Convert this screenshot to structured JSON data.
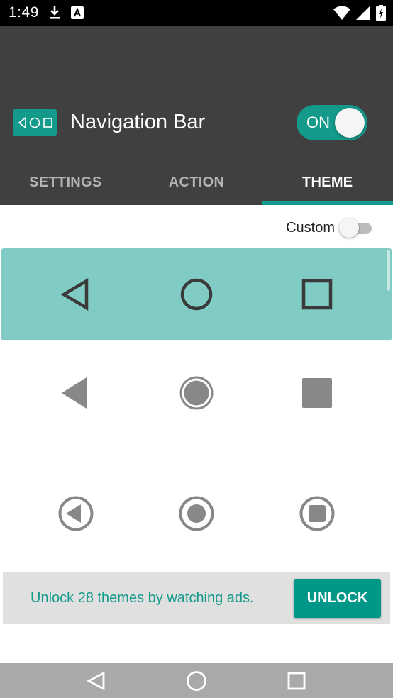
{
  "status_bar": {
    "time": "1:49",
    "left_icons": [
      "download-icon",
      "font-a-icon"
    ],
    "right_icons": [
      "wifi-icon",
      "signal-icon",
      "battery-charging-icon"
    ]
  },
  "app": {
    "title": "Navigation Bar",
    "logo_icon": "navbar-logo-icon",
    "master_toggle": {
      "label": "ON",
      "state": true
    },
    "tabs": [
      {
        "label": "SETTINGS",
        "active": false
      },
      {
        "label": "ACTION",
        "active": false
      },
      {
        "label": "THEME",
        "active": true
      }
    ]
  },
  "theme_panel": {
    "custom_label": "Custom",
    "custom_toggle_state": false,
    "themes": [
      {
        "style": "outline",
        "selected": true,
        "icons": [
          "back-icon",
          "home-icon",
          "recents-icon"
        ]
      },
      {
        "style": "filled",
        "selected": false,
        "icons": [
          "back-icon",
          "home-icon",
          "recents-icon"
        ]
      },
      {
        "style": "circled",
        "selected": false,
        "icons": [
          "back-icon",
          "home-icon",
          "recents-icon"
        ]
      }
    ]
  },
  "unlock": {
    "message": "Unlock 28 themes by watching ads.",
    "button_label": "UNLOCK"
  },
  "colors": {
    "accent": "#149a8a",
    "selected_row": "#80cbc4",
    "header_bg": "#404040",
    "icon_gray": "#888888"
  },
  "system_nav": {
    "icons": [
      "back-icon",
      "home-icon",
      "recents-icon"
    ]
  }
}
